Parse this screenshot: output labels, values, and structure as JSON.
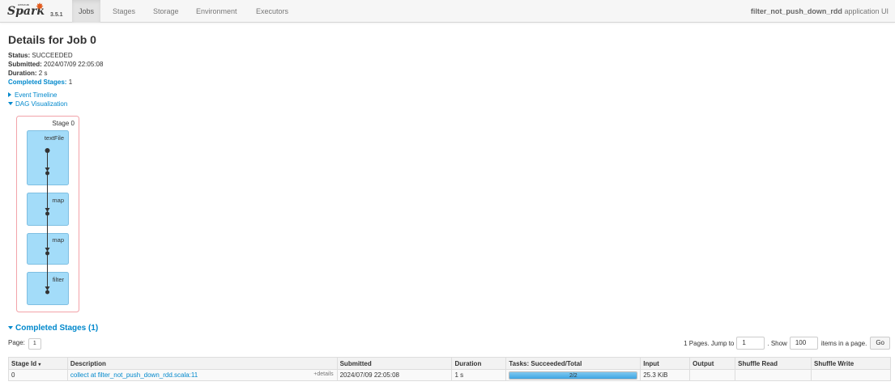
{
  "nav": {
    "brand_small": "APACHE",
    "brand": "Spark",
    "version": "3.5.1",
    "tabs": [
      {
        "label": "Jobs",
        "active": true
      },
      {
        "label": "Stages",
        "active": false
      },
      {
        "label": "Storage",
        "active": false
      },
      {
        "label": "Environment",
        "active": false
      },
      {
        "label": "Executors",
        "active": false
      }
    ],
    "app_name": "filter_not_push_down_rdd",
    "app_suffix": "application UI"
  },
  "page": {
    "title": "Details for Job 0",
    "status_label": "Status:",
    "status_value": "SUCCEEDED",
    "submitted_label": "Submitted:",
    "submitted_value": "2024/07/09 22:05:08",
    "duration_label": "Duration:",
    "duration_value": "2 s",
    "completed_stages_label": "Completed Stages:",
    "completed_stages_value": "1"
  },
  "expanders": {
    "event_timeline": "Event Timeline",
    "dag_visualization": "DAG Visualization"
  },
  "dag": {
    "stage_label": "Stage 0",
    "operations": [
      "textFile",
      "map",
      "map",
      "filter"
    ]
  },
  "completed_stages": {
    "title": "Completed Stages (1)",
    "page_label": "Page:",
    "page_value": "1",
    "pages_text": "1 Pages. Jump to",
    "jump_value": "1",
    "show_text": ". Show",
    "show_value": "100",
    "items_text": "items in a page.",
    "go_label": "Go",
    "columns": [
      "Stage Id",
      "Description",
      "Submitted",
      "Duration",
      "Tasks: Succeeded/Total",
      "Input",
      "Output",
      "Shuffle Read",
      "Shuffle Write"
    ],
    "sort_indicator": "▾",
    "row": {
      "stage_id": "0",
      "description": "collect at filter_not_push_down_rdd.scala:11",
      "details": "+details",
      "submitted": "2024/07/09 22:05:08",
      "duration": "1 s",
      "tasks": "2/2",
      "tasks_fraction": 1.0,
      "input": "25.3 KiB",
      "output": "",
      "shuffle_read": "",
      "shuffle_write": ""
    }
  },
  "colors": {
    "link": "#0088cc",
    "stage_border": "#f2a3a9",
    "rdd_fill": "#a3dcf9",
    "rdd_border": "#7fbfe2",
    "progress": "#3fa6e3"
  }
}
